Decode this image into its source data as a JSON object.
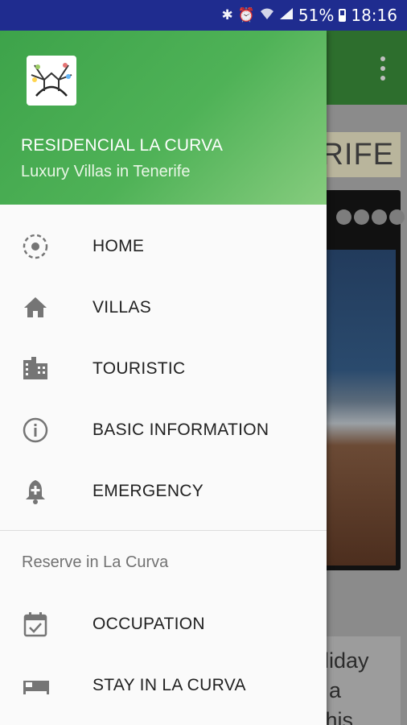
{
  "status_bar": {
    "battery": "51%",
    "time": "18:16",
    "icons": [
      "bluetooth-icon",
      "alarm-icon",
      "wifi-icon",
      "signal-icon",
      "battery-icon"
    ]
  },
  "background_app": {
    "heading_fragment": "ERIFE",
    "text_fragment": [
      "oliday",
      "y a",
      "This"
    ]
  },
  "drawer": {
    "title": "RESIDENCIAL LA CURVA",
    "subtitle": "Luxury Villas in Tenerife",
    "items": [
      {
        "label": "HOME",
        "icon": "home-circle-icon"
      },
      {
        "label": "VILLAS",
        "icon": "house-icon"
      },
      {
        "label": "TOURISTIC",
        "icon": "buildings-icon"
      },
      {
        "label": "BASIC INFORMATION",
        "icon": "info-icon"
      },
      {
        "label": "EMERGENCY",
        "icon": "bell-plus-icon"
      }
    ],
    "section_label": "Reserve in La Curva",
    "section_items": [
      {
        "label": "OCCUPATION",
        "icon": "calendar-check-icon"
      },
      {
        "label": "STAY IN LA CURVA",
        "icon": "bed-icon"
      }
    ]
  },
  "colors": {
    "status_bar": "#1f2c8f",
    "header_green": "#4fb257",
    "icon_gray": "#757575",
    "text_dark": "#212121"
  }
}
